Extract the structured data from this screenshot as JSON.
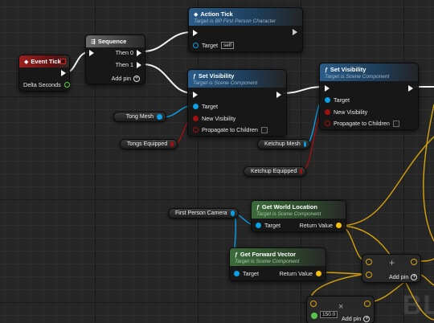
{
  "event_tick": {
    "title": "Event Tick",
    "delta_label": "Delta Seconds"
  },
  "sequence": {
    "title": "Sequence",
    "then0": "Then 0",
    "then1": "Then 1",
    "add_pin": "Add pin"
  },
  "action_tick": {
    "title": "Action Tick",
    "subtitle": "Target is BP First Person Character",
    "target_label": "Target",
    "target_value": "self"
  },
  "set_vis_1": {
    "title": "Set Visibility",
    "subtitle": "Target is Scene Component",
    "target": "Target",
    "new_vis": "New Visibility",
    "propagate": "Propagate to Children"
  },
  "set_vis_2": {
    "title": "Set Visibility",
    "subtitle": "Target is Scene Component",
    "target": "Target",
    "new_vis": "New Visibility",
    "propagate": "Propagate to Children"
  },
  "vars": {
    "tong_mesh": "Tong Mesh",
    "tongs_equipped": "Tongs Equipped",
    "ketchup_mesh": "Ketchup Mesh",
    "ketchup_equipped": "Ketchup Equipped",
    "fp_camera": "First Person Camera"
  },
  "get_world_loc": {
    "title": "Get World Location",
    "subtitle": "Target is Scene Component",
    "target": "Target",
    "ret": "Return Value"
  },
  "get_fwd": {
    "title": "Get Forward Vector",
    "subtitle": "Target is Scene Component",
    "target": "Target",
    "ret": "Return Value"
  },
  "add_node": {
    "symbol": "+",
    "add_pin": "Add pin"
  },
  "mul_node": {
    "symbol": "×",
    "value": "150.0",
    "add_pin": "Add pin"
  },
  "watermark": "BL",
  "colors": {
    "exec": "#f2f2f2",
    "object": "#0aa1e6",
    "bool": "#a01010",
    "vector": "#f4c20d",
    "float": "#58c24c"
  }
}
